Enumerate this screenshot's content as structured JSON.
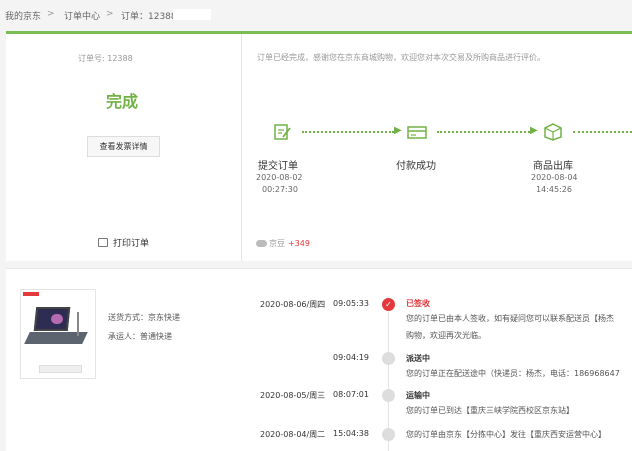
{
  "breadcrumb": {
    "home": "我的京东",
    "sep": ">",
    "center": "订单中心",
    "order": "订单：12388"
  },
  "summary": {
    "order_no": "订单号: 12388",
    "status": "完成",
    "invoice_button": "查看发票详情",
    "print": "打印订单"
  },
  "progress": {
    "notice": "订单已经完成，感谢您在京东商城购物，欢迎您对本次交易及所购商品进行评价。",
    "steps": [
      {
        "label": "提交订单",
        "date": "2020-08-02",
        "time": "00:27:30",
        "icon": "edit-document-icon"
      },
      {
        "label": "付款成功",
        "date": "",
        "time": "",
        "icon": "payment-card-icon"
      },
      {
        "label": "商品出库",
        "date": "2020-08-04",
        "time": "14:45:26",
        "icon": "package-icon"
      }
    ],
    "arrow": "▶",
    "bean_label": "京豆",
    "bean_value": "+349"
  },
  "shipping": {
    "method": "送货方式：京东快递",
    "carrier": "承运人：普通快递"
  },
  "tracking": [
    {
      "date": "2020-08-06/周四",
      "time": "09:05:33",
      "status": "已签收",
      "lines": [
        "您的订单已由本人签收，如有疑问您可以联系配送员【杨杰",
        "购物，欢迎再次光临。"
      ],
      "active": true,
      "mark": "✓"
    },
    {
      "date": "",
      "time": "09:04:19",
      "status": "派送中",
      "lines": [
        "您的订单正在配送途中（快递员：杨杰，电话：186968647"
      ],
      "active": false,
      "mark": ""
    },
    {
      "date": "2020-08-05/周三",
      "time": "08:07:01",
      "status": "运输中",
      "lines": [
        "您的订单已到达【重庆三峡学院西校区京东站】"
      ],
      "active": false,
      "mark": ""
    },
    {
      "date": "2020-08-04/周二",
      "time": "15:04:38",
      "status": "",
      "lines": [
        "您的订单由京东【分拣中心】发往【重庆西安运营中心】"
      ],
      "active": false,
      "mark": ""
    }
  ],
  "colors": {
    "accent": "#71b247",
    "alert": "#e4393c"
  }
}
